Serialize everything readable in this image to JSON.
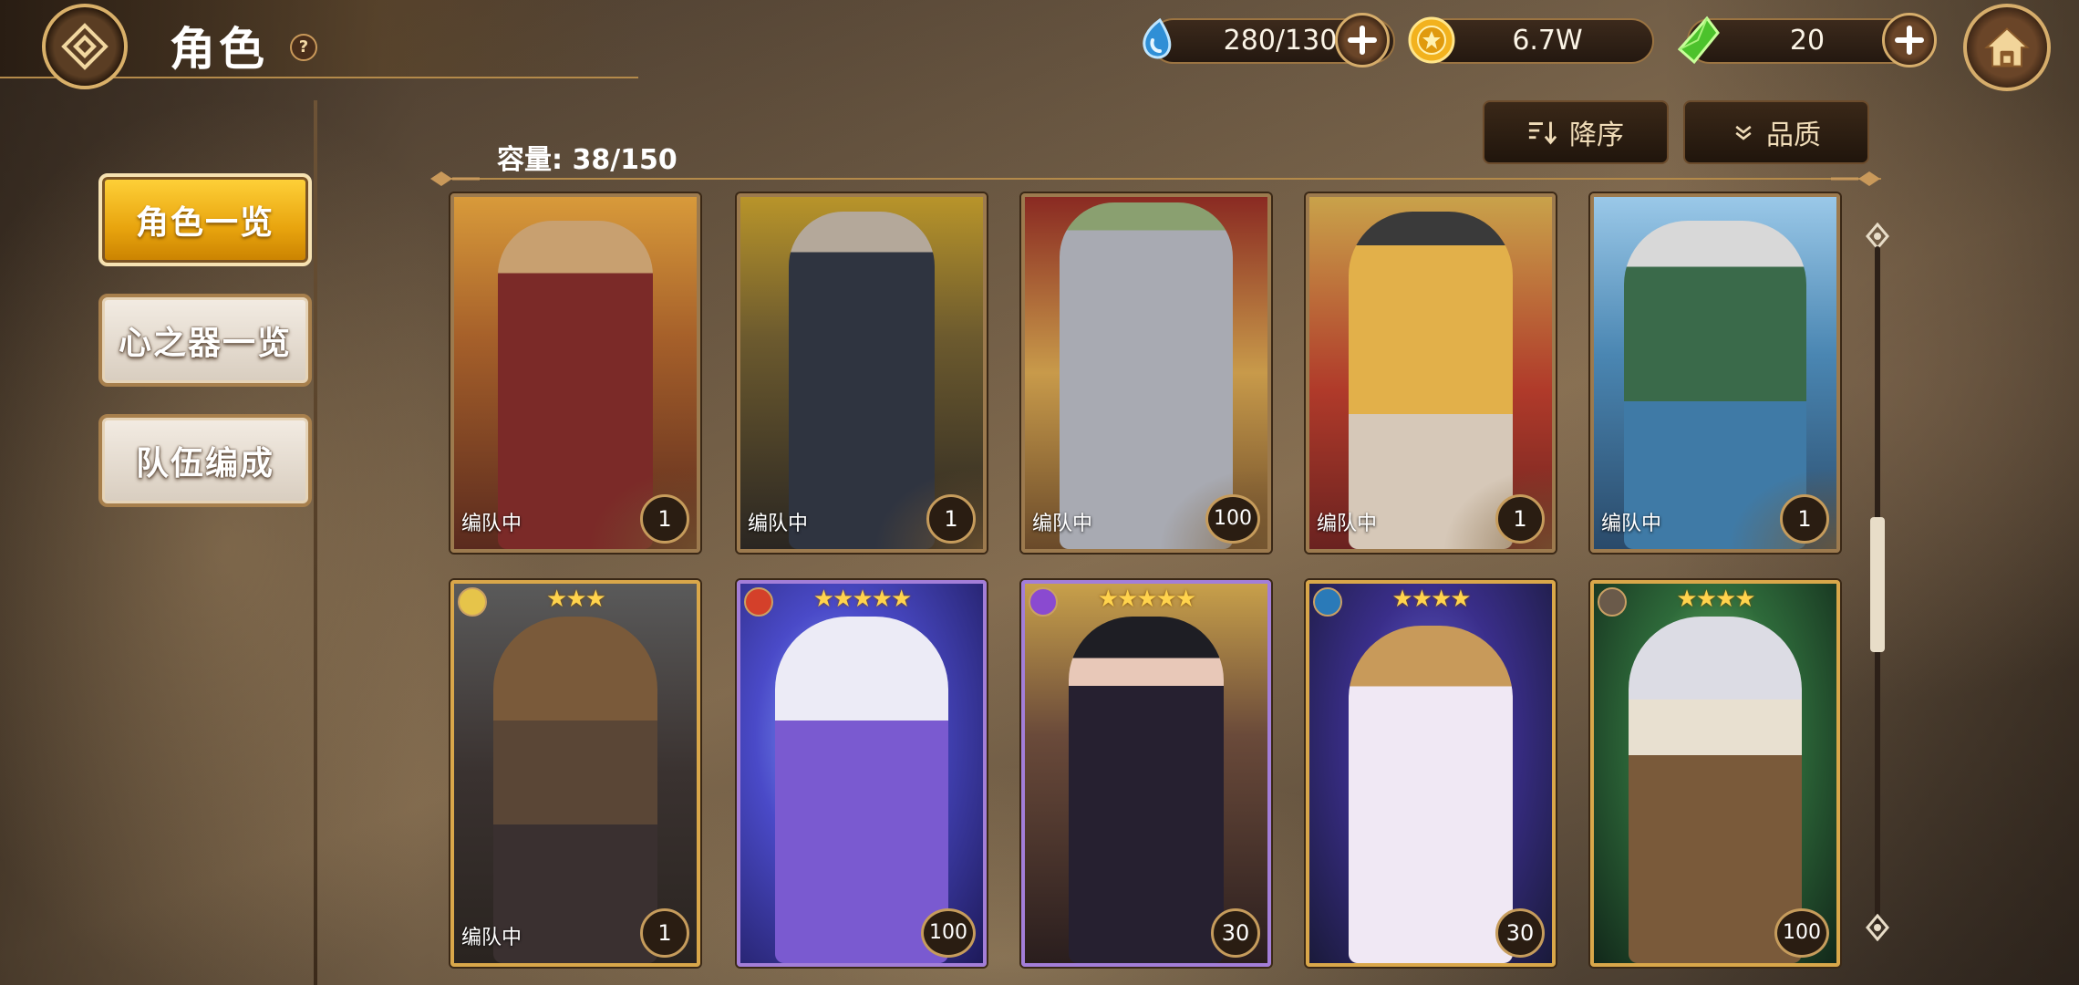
{
  "header": {
    "title": "角色",
    "help_label": "?"
  },
  "currencies": [
    {
      "name": "stamina",
      "value": "280/130",
      "icon": "water-drop-icon",
      "color": "#3aa6e8"
    },
    {
      "name": "gold",
      "value": "6.7W",
      "icon": "gold-coin-icon",
      "color": "#f2b21e"
    },
    {
      "name": "gem",
      "value": "20",
      "icon": "green-crystal-icon",
      "color": "#5ed43a"
    }
  ],
  "sidebar": {
    "items": [
      {
        "label": "角色一览",
        "active": true
      },
      {
        "label": "心之器一览",
        "active": false
      },
      {
        "label": "队伍编成",
        "active": false
      }
    ]
  },
  "main": {
    "capacity": "容量: 38/150",
    "sort_label": "降序",
    "filter_label": "品质"
  },
  "cards_row1": [
    {
      "status": "编队中",
      "level": "1",
      "theme": "#7b2a28"
    },
    {
      "status": "编队中",
      "level": "1",
      "theme": "#2f3440"
    },
    {
      "status": "编队中",
      "level": "100",
      "theme": "#8a8c94"
    },
    {
      "status": "编队中",
      "level": "1",
      "theme": "#c99a3a"
    },
    {
      "status": "编队中",
      "level": "1",
      "theme": "#3f7aa6"
    }
  ],
  "cards_row2": [
    {
      "stars": "★★★",
      "status": "编队中",
      "level": "1",
      "theme": "#5a4636",
      "element_color": "#e6c44a"
    },
    {
      "stars": "★★★★★",
      "status": "",
      "level": "100",
      "theme": "#3a3ab8",
      "element_color": "#d4402a"
    },
    {
      "stars": "★★★★★",
      "status": "",
      "level": "30",
      "theme": "#4a2e2a",
      "element_color": "#8a4ad0"
    },
    {
      "stars": "★★★★",
      "status": "",
      "level": "30",
      "theme": "#4b3a9c",
      "element_color": "#2a7ab8"
    },
    {
      "stars": "★★★★",
      "status": "",
      "level": "100",
      "theme": "#2e5a3a",
      "element_color": "#6a5a4a"
    }
  ]
}
